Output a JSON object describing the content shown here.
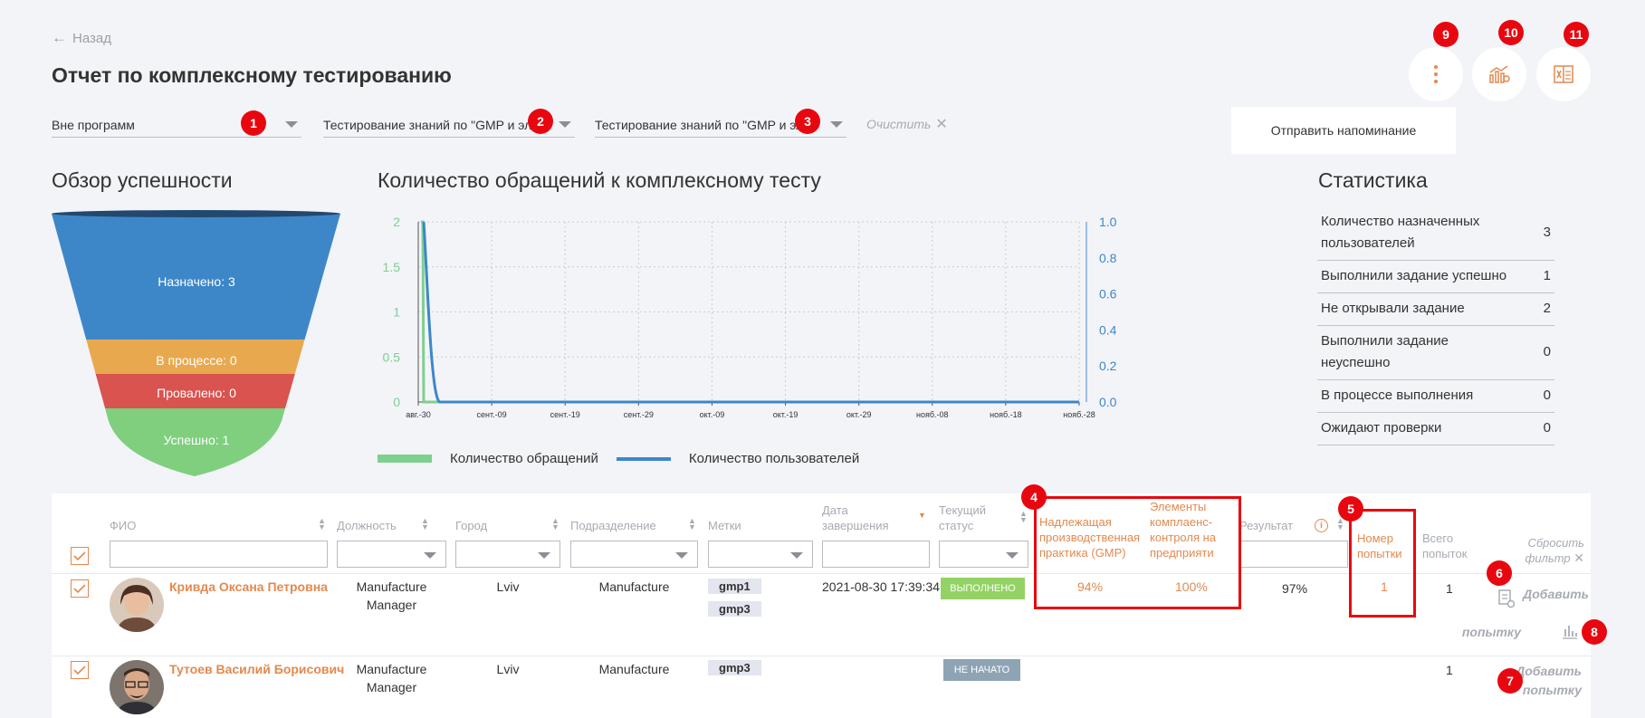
{
  "nav": {
    "back_label": "Назад"
  },
  "page": {
    "title": "Отчет по комплексному тестированию"
  },
  "filters": [
    {
      "value": "Вне программ"
    },
    {
      "value": "Тестирование знаний по \"GMP и эл"
    },
    {
      "value": "Тестирование знаний по \"GMP и эл"
    }
  ],
  "clear_label": "Очистить",
  "markers": [
    "1",
    "2",
    "3",
    "4",
    "5",
    "6",
    "7",
    "8",
    "9",
    "10",
    "11"
  ],
  "toolbar": {
    "more_icon": "more-vertical-icon",
    "analytics_icon": "analytics-icon",
    "excel_icon": "excel-export-icon"
  },
  "reminder_label": "Отправить напоминание",
  "funnel": {
    "title": "Обзор успешности",
    "stages": [
      {
        "label": "Назначено: 3",
        "value": 3,
        "color": "#3d87c9"
      },
      {
        "label": "В процессе: 0",
        "value": 0,
        "color": "#e8a94e"
      },
      {
        "label": "Провалено: 0",
        "value": 0,
        "color": "#d9534f"
      },
      {
        "label": "Успешно: 1",
        "value": 1,
        "color": "#7fcf7f"
      }
    ]
  },
  "chart_title": "Количество обращений к комплексному тесту",
  "chart_data": {
    "type": "line",
    "x": [
      "авг.-30",
      "сент.-09",
      "сент.-19",
      "сент.-29",
      "окт.-09",
      "окт.-19",
      "окт.-29",
      "нояб.-08",
      "нояб.-18",
      "нояб.-28"
    ],
    "y_left_ticks": [
      "0",
      "0.5",
      "1",
      "1.5",
      "2"
    ],
    "y_right_ticks": [
      "0.0",
      "0.2",
      "0.4",
      "0.6",
      "0.8",
      "1.0"
    ],
    "ylim_left": [
      0,
      2
    ],
    "ylim_right": [
      0,
      1
    ],
    "grid": true,
    "legend_position": "bottom",
    "series": [
      {
        "name": "Количество обращений",
        "color": "#7fcf8f",
        "axis": "left",
        "values": [
          2,
          0,
          0,
          0,
          0,
          0,
          0,
          0,
          0,
          0
        ]
      },
      {
        "name": "Количество пользователей",
        "color": "#3d87c9",
        "axis": "right",
        "values": [
          1,
          0,
          0,
          0,
          0,
          0,
          0,
          0,
          0,
          0
        ]
      }
    ]
  },
  "stats": {
    "title": "Статистика",
    "rows": [
      {
        "label": "Количество назначенных пользователей",
        "value": "3"
      },
      {
        "label": "Выполнили задание успешно",
        "value": "1"
      },
      {
        "label": "Не открывали задание",
        "value": "2"
      },
      {
        "label": "Выполнили задание неуспешно",
        "value": "0"
      },
      {
        "label": "В процессе выполнения",
        "value": "0"
      },
      {
        "label": "Ожидают проверки",
        "value": "0"
      }
    ]
  },
  "table": {
    "columns": {
      "fio": "ФИО",
      "position": "Должность",
      "city": "Город",
      "department": "Подразделение",
      "tags": "Метки",
      "end_date_1": "Дата",
      "end_date_2": "завершения",
      "status_1": "Текущий",
      "status_2": "статус",
      "gmp_1": "Надлежащая",
      "gmp_2": "производственная",
      "gmp_3": "практика (GMP)",
      "compliance_1": "Элементы",
      "compliance_2": "комплаенс-",
      "compliance_3": "контроля на",
      "compliance_4": "предприяти",
      "result": "Результат",
      "attempt_1": "Номер",
      "attempt_2": "попытки",
      "total_1": "Всего",
      "total_2": "попыток"
    },
    "reset_1": "Сбросить",
    "reset_2": "фильтр",
    "rows": [
      {
        "name": "Кривда Оксана Петровна",
        "position_1": "Manufacture",
        "position_2": "Manager",
        "city": "Lviv",
        "department": "Manufacture",
        "tags": [
          "gmp1",
          "gmp3"
        ],
        "end_date": "2021-08-30 17:39:34",
        "status": "ВЫПОЛНЕНО",
        "status_color": "#93d365",
        "gmp": "94%",
        "compliance": "100%",
        "result": "97%",
        "attempt": "1",
        "total": "1",
        "action_1": "Добавить",
        "action_2": "попытку"
      },
      {
        "name": "Тутоев Василий Борисович",
        "position_1": "Manufacture",
        "position_2": "Manager",
        "city": "Lviv",
        "department": "Manufacture",
        "tags": [
          "gmp3"
        ],
        "end_date": "",
        "status": "НЕ НАЧАТО",
        "status_color": "#8ea4b5",
        "gmp": "",
        "compliance": "",
        "result": "",
        "attempt": "",
        "total": "1",
        "action_1": "Добавить",
        "action_2": "попытку"
      }
    ]
  }
}
